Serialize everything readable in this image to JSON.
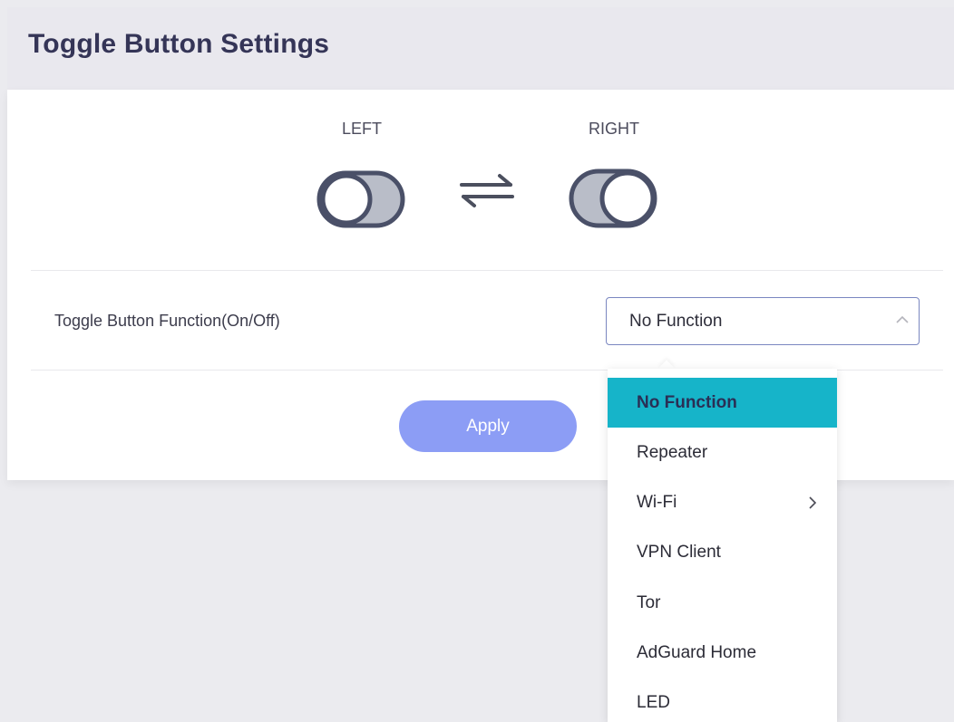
{
  "header": {
    "title": "Toggle Button Settings"
  },
  "switch": {
    "left_label": "LEFT",
    "right_label": "RIGHT"
  },
  "function_row": {
    "label": "Toggle Button Function(On/Off)",
    "selected_value": "No Function"
  },
  "apply_label": "Apply",
  "dropdown": {
    "items": [
      {
        "label": "No Function",
        "selected": true
      },
      {
        "label": "Repeater"
      },
      {
        "label": "Wi-Fi",
        "has_submenu": true
      },
      {
        "label": "VPN Client"
      },
      {
        "label": "Tor"
      },
      {
        "label": "AdGuard Home"
      },
      {
        "label": "LED"
      }
    ]
  },
  "icons": {
    "toggle_left": "toggle-off-icon",
    "toggle_right": "toggle-on-icon",
    "swap": "swap-arrows-icon",
    "chevron_up": "chevron-up-icon",
    "chevron_right": "chevron-right-icon"
  },
  "colors": {
    "title": "#353557",
    "apply_button": "#8c9df5",
    "selected_item": "#16b4c9",
    "select_border": "#7a86c0",
    "toggle_stroke": "#4a5068",
    "toggle_fill": "#b9bdc8"
  }
}
